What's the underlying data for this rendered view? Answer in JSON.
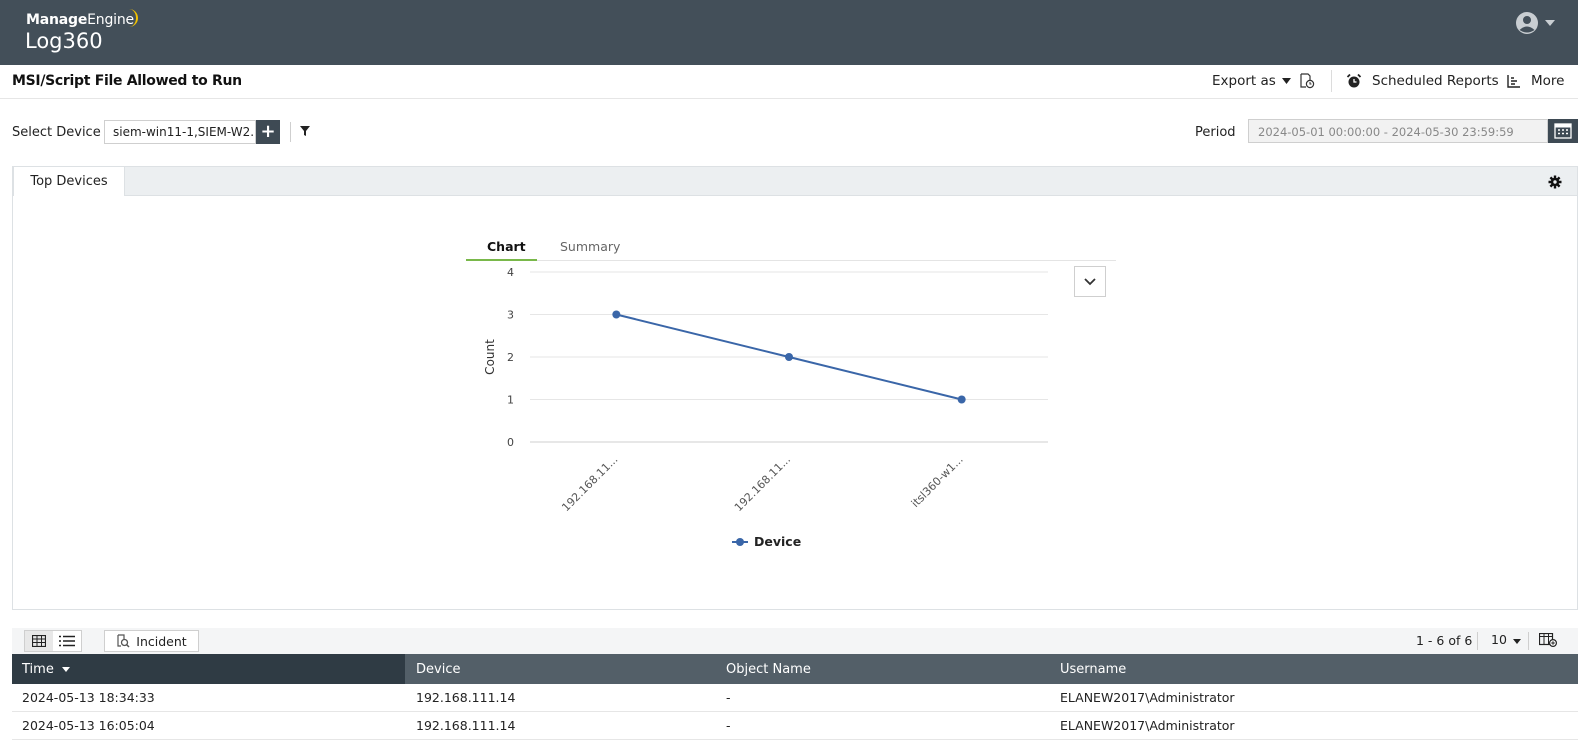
{
  "header": {
    "brand_top_bold": "Manage",
    "brand_top_light": "Engine",
    "product": "Log360"
  },
  "report": {
    "title": "MSI/Script File Allowed to Run",
    "export_label": "Export as",
    "scheduled_label": "Scheduled Reports",
    "more_label": "More"
  },
  "filters": {
    "device_label": "Select Device",
    "device_value": "siem-win11-1,SIEM-W2...",
    "period_label": "Period",
    "period_value": "2024-05-01 00:00:00 - 2024-05-30 23:59:59"
  },
  "tabs": {
    "top_devices": "Top Devices"
  },
  "chart_tabs": {
    "chart": "Chart",
    "summary": "Summary"
  },
  "chart_data": {
    "type": "line",
    "categories": [
      "192.168.11...",
      "192.168.11...",
      "itsl360-w1..."
    ],
    "series": [
      {
        "name": "Device",
        "values": [
          3,
          2,
          1
        ],
        "color": "#3a66a8"
      }
    ],
    "ylabel": "Count",
    "ylim": [
      0,
      4
    ],
    "yticks": [
      0,
      1,
      2,
      3,
      4
    ],
    "grid": true,
    "legend": "bottom-center"
  },
  "grid_toolbar": {
    "incident_label": "Incident",
    "pager": "1 - 6 of 6",
    "per_page": "10"
  },
  "table": {
    "columns": [
      "Time",
      "Device",
      "Object Name",
      "Username"
    ],
    "rows": [
      [
        "2024-05-13 18:34:33",
        "192.168.111.14",
        "-",
        "ELANEW2017\\Administrator"
      ],
      [
        "2024-05-13 16:05:04",
        "192.168.111.14",
        "-",
        "ELANEW2017\\Administrator"
      ]
    ]
  }
}
